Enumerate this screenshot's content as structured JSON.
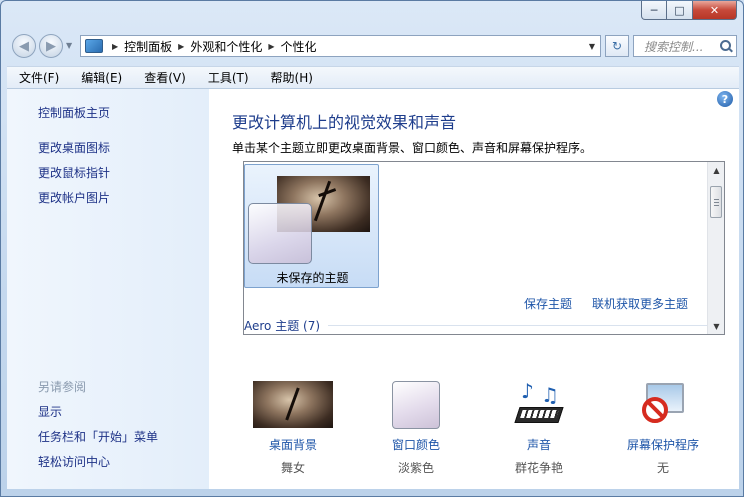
{
  "window": {
    "controls": {
      "minimize": "─",
      "maximize": "□",
      "close": "✕"
    }
  },
  "nav": {
    "back": "◀",
    "forward": "▶",
    "breadcrumbs": [
      "控制面板",
      "外观和个性化",
      "个性化"
    ],
    "search_placeholder": "搜索控制...",
    "refresh": "↻"
  },
  "menu": [
    "文件(F)",
    "编辑(E)",
    "查看(V)",
    "工具(T)",
    "帮助(H)"
  ],
  "sidebar": {
    "links": [
      "控制面板主页",
      "更改桌面图标",
      "更改鼠标指针",
      "更改帐户图片"
    ],
    "see_also_heading": "另请参阅",
    "see_also": [
      "显示",
      "任务栏和「开始」菜单",
      "轻松访问中心"
    ]
  },
  "main": {
    "title": "更改计算机上的视觉效果和声音",
    "subtitle": "单击某个主题立即更改桌面背景、窗口颜色、声音和屏幕保护程序。",
    "help": "?",
    "themes": {
      "selected_label": "未保存的主题",
      "save_link": "保存主题",
      "online_link": "联机获取更多主题",
      "aero_heading": "Aero 主题 (7)"
    }
  },
  "bottom": [
    {
      "title": "桌面背景",
      "value": "舞女"
    },
    {
      "title": "窗口颜色",
      "value": "淡紫色"
    },
    {
      "title": "声音",
      "value": "群花争艳"
    },
    {
      "title": "屏幕保护程序",
      "value": "无"
    }
  ],
  "colors": {
    "link": "#1e55a8",
    "title": "#1e3d8c",
    "sidebar_link": "#1e3287",
    "accent_close": "#c7493a"
  }
}
